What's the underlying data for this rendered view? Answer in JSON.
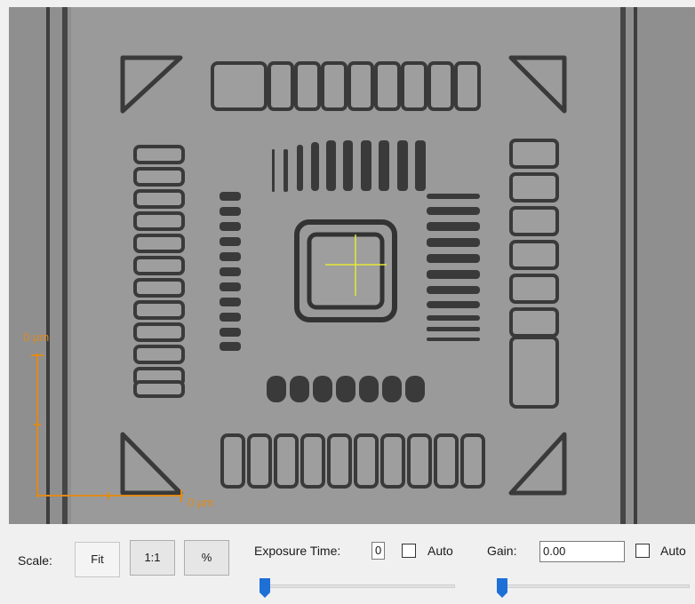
{
  "viewer": {
    "scale_x_label": "0 µm",
    "scale_y_label": "0 µm",
    "accent_color": "#e08a1a",
    "crosshair_color": "#e6e63a"
  },
  "controls": {
    "scale_label": "Scale:",
    "fit_label": "Fit",
    "one_to_one_label": "1:1",
    "percent_label": "%",
    "exposure_label": "Exposure Time:",
    "exposure_value": "0",
    "exposure_auto_label": "Auto",
    "exposure_auto_checked": false,
    "exposure_slider_level": 0,
    "gain_label": "Gain:",
    "gain_value": "0.00",
    "gain_auto_label": "Auto",
    "gain_auto_checked": false,
    "gain_slider_level": 0,
    "slider_thumb_color": "#1e6fd6"
  }
}
